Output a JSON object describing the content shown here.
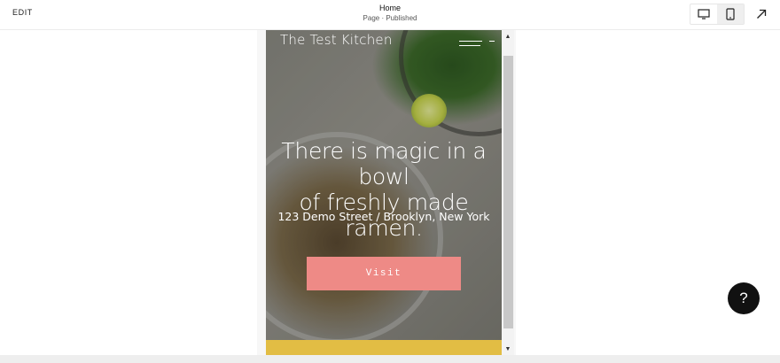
{
  "editor": {
    "edit_label": "EDIT",
    "page_title": "Home",
    "page_status": "Page · Published",
    "active_device": "mobile"
  },
  "site": {
    "title": "The Test Kitchen",
    "headline_line1": "There is magic in a bowl",
    "headline_line2": "of freshly made ramen.",
    "address": "123 Demo Street / Brooklyn, New York",
    "cta_label": "Visit",
    "cta_color": "#ee8a86",
    "band_color": "#e2bd44"
  },
  "help": {
    "label": "?"
  }
}
